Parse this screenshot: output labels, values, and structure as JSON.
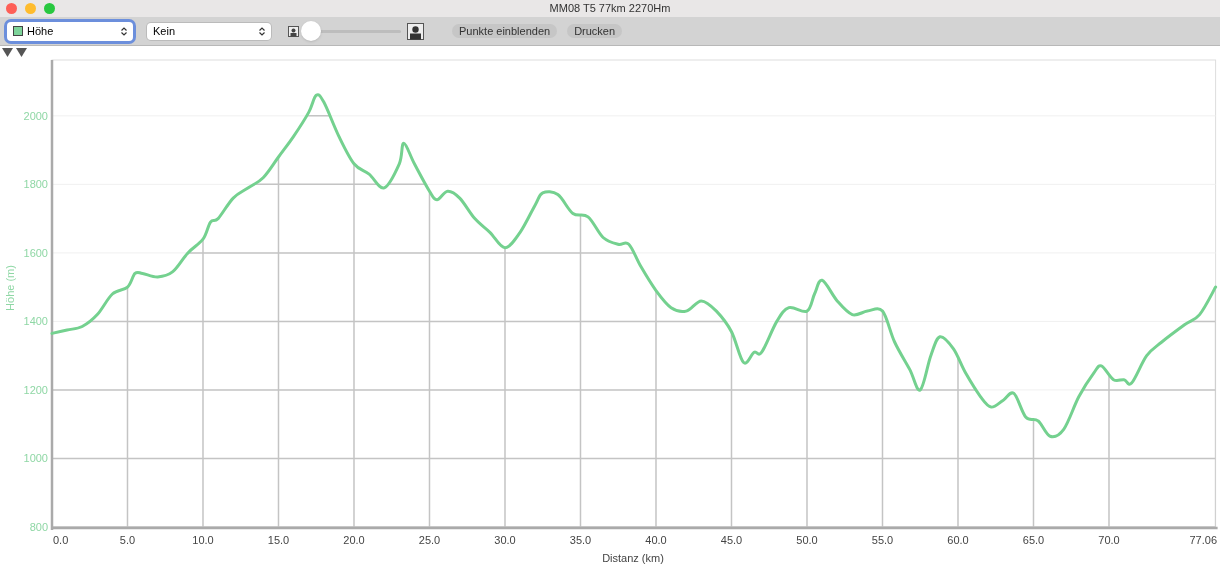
{
  "window": {
    "title": "MM08 T5 77km 2270Hm"
  },
  "toolbar": {
    "series_select": {
      "value": "Höhe",
      "color": "#7dd49a",
      "focused": true
    },
    "second_select": {
      "value": "Kein",
      "focused": false
    },
    "zoom_slider": {
      "level": 0
    },
    "buttons": [
      "Punkte einblenden",
      "Drucken"
    ]
  },
  "chart": {
    "chart_data": {
      "type": "line",
      "xlabel": "Distanz (km)",
      "ylabel": "Höhe (m)",
      "x": [
        0,
        1,
        2,
        3,
        4,
        5,
        5.5,
        6,
        7,
        8,
        9,
        10,
        10.5,
        11,
        12,
        13,
        14,
        15,
        16,
        17,
        17.5,
        18,
        19,
        20,
        21,
        22,
        23,
        23.3,
        24,
        25,
        25.5,
        26.2,
        27,
        28,
        29,
        30,
        31,
        32,
        32.5,
        33.5,
        34.5,
        35.5,
        36.5,
        37.5,
        38.2,
        39,
        40,
        41,
        42,
        43,
        44,
        45,
        45.8,
        46.5,
        47,
        48,
        48.8,
        50,
        50.5,
        51,
        52,
        53,
        54,
        55,
        55.8,
        56.8,
        57.5,
        58.2,
        58.8,
        59.7,
        60.5,
        61.5,
        62.2,
        63,
        63.7,
        64.5,
        65.3,
        66.1,
        67,
        68,
        69,
        69.5,
        70.3,
        71,
        71.5,
        72.5,
        73.5,
        75,
        76,
        77.06
      ],
      "grid": true,
      "series": [
        {
          "color": "#74d18f",
          "values": [
            1365,
            1375,
            1385,
            1420,
            1480,
            1500,
            1540,
            1540,
            1530,
            1545,
            1600,
            1640,
            1690,
            1700,
            1760,
            1790,
            1820,
            1880,
            1940,
            2010,
            2060,
            2040,
            1940,
            1860,
            1830,
            1790,
            1860,
            1920,
            1860,
            1780,
            1755,
            1780,
            1760,
            1700,
            1660,
            1615,
            1660,
            1740,
            1775,
            1770,
            1715,
            1705,
            1645,
            1625,
            1625,
            1560,
            1490,
            1440,
            1430,
            1460,
            1430,
            1370,
            1280,
            1310,
            1310,
            1400,
            1440,
            1430,
            1480,
            1520,
            1460,
            1420,
            1430,
            1430,
            1340,
            1260,
            1200,
            1300,
            1355,
            1320,
            1250,
            1180,
            1150,
            1170,
            1190,
            1120,
            1110,
            1065,
            1085,
            1180,
            1250,
            1270,
            1230,
            1230,
            1220,
            1300,
            1340,
            1390,
            1420,
            1500
          ]
        }
      ],
      "xlim": [
        0,
        77.06
      ],
      "ylim": [
        797,
        2163
      ],
      "xticks": [
        {
          "value": 0,
          "label": "0.0"
        },
        {
          "value": 5,
          "label": "5.0"
        },
        {
          "value": 10,
          "label": "10.0"
        },
        {
          "value": 15,
          "label": "15.0"
        },
        {
          "value": 20,
          "label": "20.0"
        },
        {
          "value": 25,
          "label": "25.0"
        },
        {
          "value": 30,
          "label": "30.0"
        },
        {
          "value": 35,
          "label": "35.0"
        },
        {
          "value": 40,
          "label": "40.0"
        },
        {
          "value": 45,
          "label": "45.0"
        },
        {
          "value": 50,
          "label": "50.0"
        },
        {
          "value": 55,
          "label": "55.0"
        },
        {
          "value": 60,
          "label": "60.0"
        },
        {
          "value": 65,
          "label": "65.0"
        },
        {
          "value": 70,
          "label": "70.0"
        },
        {
          "value": 77.06,
          "label": "77.06"
        }
      ],
      "yticks": [
        800,
        1000,
        1200,
        1400,
        1600,
        1800,
        2000
      ]
    }
  }
}
